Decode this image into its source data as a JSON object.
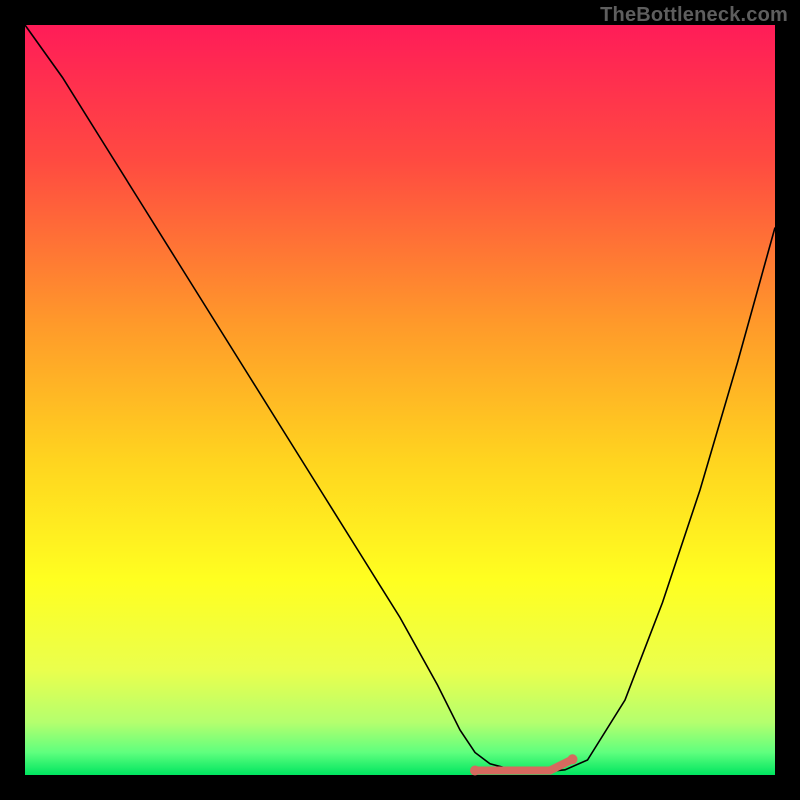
{
  "watermark": "TheBottleneck.com",
  "colors": {
    "frame": "#000000",
    "curve": "#000000",
    "marker": "#d66a5f",
    "gradient_stops": [
      {
        "pct": 0,
        "color": "#ff1c58"
      },
      {
        "pct": 18,
        "color": "#ff4a41"
      },
      {
        "pct": 40,
        "color": "#ff9a2a"
      },
      {
        "pct": 58,
        "color": "#ffd41f"
      },
      {
        "pct": 74,
        "color": "#ffff20"
      },
      {
        "pct": 86,
        "color": "#eaff4d"
      },
      {
        "pct": 93,
        "color": "#b4ff6e"
      },
      {
        "pct": 97,
        "color": "#5fff7e"
      },
      {
        "pct": 100,
        "color": "#00e560"
      }
    ]
  },
  "chart_data": {
    "type": "line",
    "title": "",
    "xlabel": "",
    "ylabel": "",
    "xlim": [
      0,
      100
    ],
    "ylim": [
      0,
      100
    ],
    "series": [
      {
        "name": "bottleneck-curve",
        "x": [
          0,
          5,
          10,
          15,
          20,
          25,
          30,
          35,
          40,
          45,
          50,
          55,
          58,
          60,
          62,
          65,
          68,
          70,
          72,
          75,
          80,
          85,
          90,
          95,
          100
        ],
        "y": [
          100,
          93,
          85,
          77,
          69,
          61,
          53,
          45,
          37,
          29,
          21,
          12,
          6,
          3,
          1.5,
          0.7,
          0.5,
          0.5,
          0.7,
          2,
          10,
          23,
          38,
          55,
          73
        ]
      }
    ],
    "optimal_range": {
      "x_start": 60,
      "x_end": 73,
      "y": 0.6
    },
    "legend": [],
    "grid": false,
    "annotations": []
  }
}
